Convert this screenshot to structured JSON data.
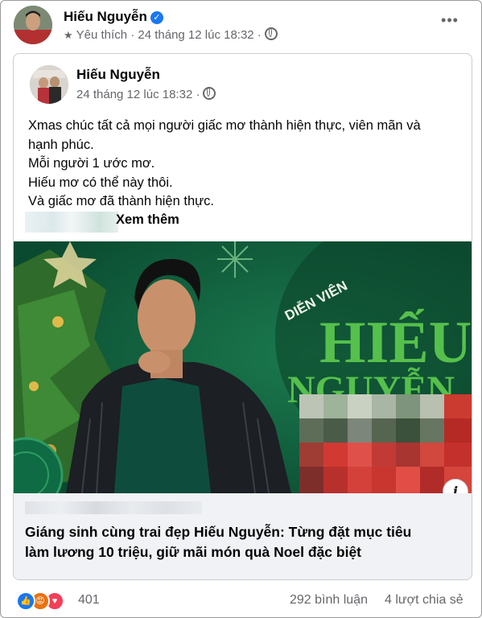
{
  "post": {
    "author": "Hiếu Nguyễn",
    "meta": "Yêu thích · 24 tháng 12 lúc 18:32 ·",
    "more_label": "•••",
    "star_icon": "star-icon",
    "globe_icon": "globe-icon"
  },
  "shared": {
    "author": "Hiếu Nguyễn",
    "meta": "24 tháng 12 lúc 18:32 ·",
    "lines": [
      "Xmas chúc tất cả mọi người giấc mơ thành hiện thực, viên mãn và",
      "hạnh phúc.",
      "Mỗi người 1 ước mơ.",
      "Hiếu mơ có thể này thôi.",
      "Và giấc mơ đã thành hiện thực."
    ],
    "see_more": "Xem thêm"
  },
  "media": {
    "poster_small_text": "DIỄN VIÊN",
    "poster_line1": "HIẾU",
    "poster_line2": "NGUYỄN",
    "info_label": "i"
  },
  "link": {
    "title_line1": "Giáng sinh cùng trai đẹp Hiếu Nguyễn: Từng đặt mục tiêu",
    "title_line2": "làm lương 10 triệu, giữ mãi món quà Noel đặc biệt"
  },
  "footer": {
    "reaction_count": "401",
    "comments": "292 bình luận",
    "shares": "4 lượt chia sẻ"
  },
  "colors": {
    "accent_blue": "#1877f2",
    "angry_orange": "#e9710f",
    "love_red": "#f33e58",
    "poster_green": "#0e5a3a",
    "poster_text_green": "#56c04c"
  }
}
